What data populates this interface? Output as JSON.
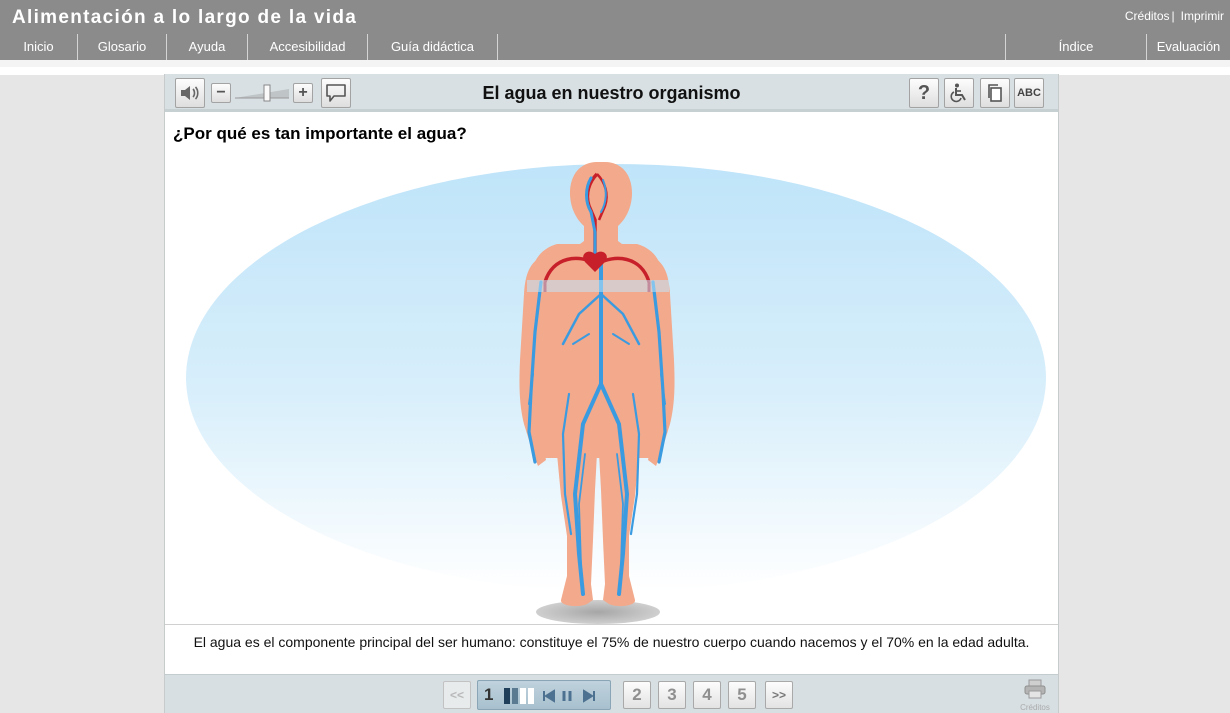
{
  "app": {
    "title": "Alimentación a lo largo de la vida"
  },
  "top_links": {
    "credits": "Créditos",
    "separator": "|",
    "print": "Imprimir"
  },
  "nav": {
    "left": [
      "Inicio",
      "Glosario",
      "Ayuda",
      "Accesibilidad",
      "Guía didáctica"
    ],
    "right": [
      "Índice",
      "Evaluación"
    ]
  },
  "toolbar": {
    "audio_icon": "speaker-icon",
    "zoom_out": "−",
    "zoom_in": "+",
    "speech_icon": "speech-bubble-icon",
    "title": "El agua en nuestro organismo",
    "help": "?",
    "accessibility_icon": "wheelchair-icon",
    "pages_icon": "copy-icon",
    "abc": "ABC"
  },
  "content": {
    "question": "¿Por qué es tan importante el agua?",
    "caption": "El agua es el componente principal del ser humano: constituye el 75% de nuestro cuerpo cuando nacemos y el 70% en la edad adulta."
  },
  "pager": {
    "first": "<<",
    "current": "1",
    "pages": [
      "2",
      "3",
      "4",
      "5"
    ],
    "next": ">>",
    "print_label": "Créditos"
  },
  "colors": {
    "header": "#8b8b8c",
    "toolbar": "#d8e0e3",
    "body_skin": "#f3a98b",
    "artery": "#c8202a",
    "vein": "#3b9be0",
    "halo": "#c3e6fa"
  }
}
